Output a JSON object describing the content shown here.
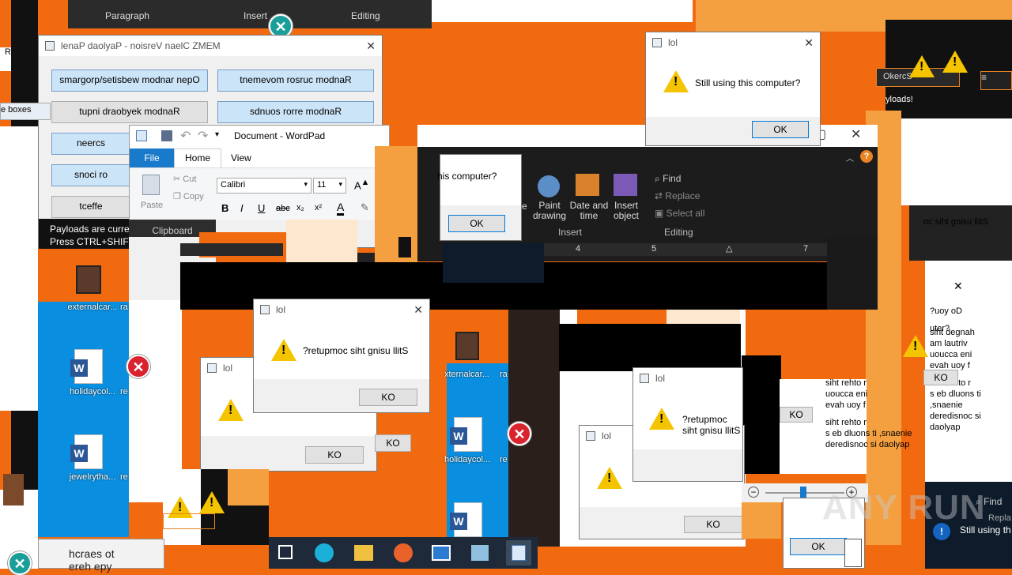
{
  "bg_color": "#f26a10",
  "top_ribbon": {
    "paragraph": "Paragraph",
    "insert": "Insert",
    "editing": "Editing"
  },
  "memz_window": {
    "title": "lenaP daolyaP - noisreV naelC ZMEM",
    "buttons": [
      "smargorp/setisbew modnar nepO",
      "tnemevom rosruc modnaR",
      "tupni draobyek modnaR",
      "sdnuos rorre modnaR",
      "neercs",
      "snoci ro",
      "tceffe"
    ],
    "status1": "Payloads are current",
    "status2": "Press CTRL+SHIFT+"
  },
  "wordpad": {
    "title": "Document - WordPad",
    "tabs": [
      "File",
      "Home",
      "View"
    ],
    "clipboard": {
      "paste": "Paste",
      "cut": "Cut",
      "copy": "Copy",
      "group": "Clipboard"
    },
    "font_name": "Calibri",
    "font_size": "11",
    "insert_group": {
      "paint": "Paint drawing",
      "datetime": "Date and time",
      "object": "Insert object",
      "partial": "re",
      "group": "Insert"
    },
    "editing_group": {
      "find": "Find",
      "replace": "Replace",
      "select_all": "Select all",
      "group": "Editing"
    },
    "ruler": [
      "4",
      "5",
      "7"
    ]
  },
  "dialogs": {
    "title": "lol",
    "msg": "Still using this computer?",
    "msg_rev": "?retupmoc siht gnisu llitS",
    "msg_partial": "his computer?",
    "ok": "OK",
    "ok_rev": "KO"
  },
  "desktop": {
    "externalcar": "externalcar...",
    "holiday": "holidaycol...",
    "jewelry": "jewelrytha...",
    "holiday2": "holidaycol...",
    "xternal": "xternalcar...",
    "ra": "ra",
    "re": "re"
  },
  "left_edge": {
    "boxes": "e boxes",
    "ko": "KO",
    "r": "R"
  },
  "right_text": {
    "oc": "oc siht gnisu llitS",
    "doyou": "?uoy oD",
    "uter": "uter?",
    "lines": [
      "siht degnah",
      "am lautriv",
      "uoucca eni",
      "evah uoy f",
      "siht rehto r",
      "s eb dluons ti ,snaenie",
      "deredisnoc si daolyap"
    ],
    "okercs": "OkercS",
    "payloads": "yloads!",
    "stillusing": "Still using this computer?",
    "stillusing2": "Still using th",
    "find": "Find",
    "repl": "Repla"
  },
  "search_box": "hcraes ot ereh epy",
  "watermark": "ANY RUN",
  "taskbar": {
    "items": [
      "task-view",
      "edge",
      "explorer",
      "firefox",
      "app",
      "notepad",
      "wordpad"
    ]
  }
}
